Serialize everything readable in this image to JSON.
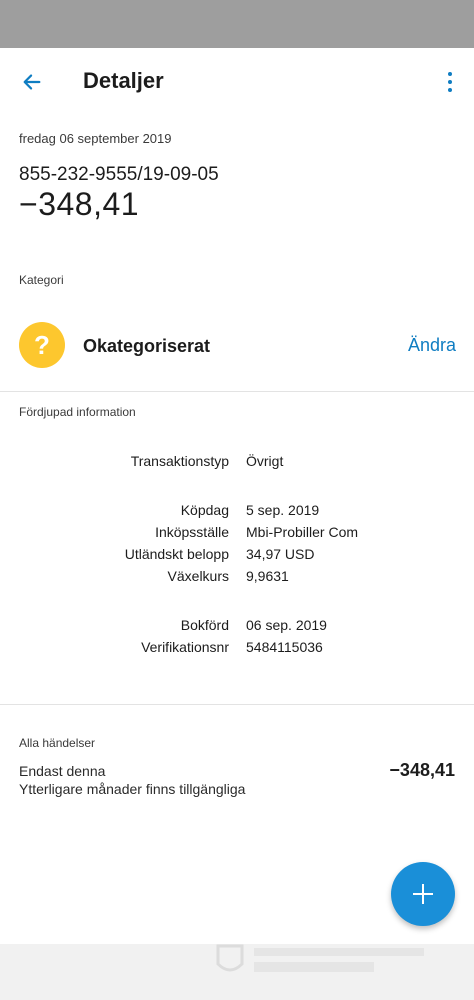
{
  "app_bar": {
    "title": "Detaljer"
  },
  "transaction": {
    "date": "fredag 06 september 2019",
    "reference": "855-232-9555/19-09-05",
    "amount": "−348,41"
  },
  "category": {
    "section_label": "Kategori",
    "icon_glyph": "?",
    "name": "Okategoriserat",
    "change_label": "Ändra",
    "icon_color": "#fdc72e"
  },
  "details": {
    "section_label": "Fördjupad information",
    "rows": [
      {
        "label": "Transaktionstyp",
        "value": "Övrigt"
      },
      {
        "label": "Köpdag",
        "value": "5 sep. 2019"
      },
      {
        "label": "Inköpsställe",
        "value": "Mbi-Probiller Com"
      },
      {
        "label": "Utländskt belopp",
        "value": "34,97 USD"
      },
      {
        "label": "Växelkurs",
        "value": "9,9631"
      },
      {
        "label": "Bokförd",
        "value": "06 sep. 2019"
      },
      {
        "label": "Verifikationsnr",
        "value": "5484115036"
      }
    ]
  },
  "events": {
    "section_label": "Alla händelser",
    "title": "Endast denna",
    "subtitle": "Ytterligare månader finns tillgängliga",
    "amount": "−348,41"
  },
  "colors": {
    "accent": "#0f7dc2",
    "fab": "#1a8fd8",
    "status_bar": "#9e9e9e"
  },
  "icons": {
    "back": "arrow-left-icon",
    "more": "more-vertical-icon",
    "category": "question-mark-icon",
    "fab": "plus-icon"
  }
}
